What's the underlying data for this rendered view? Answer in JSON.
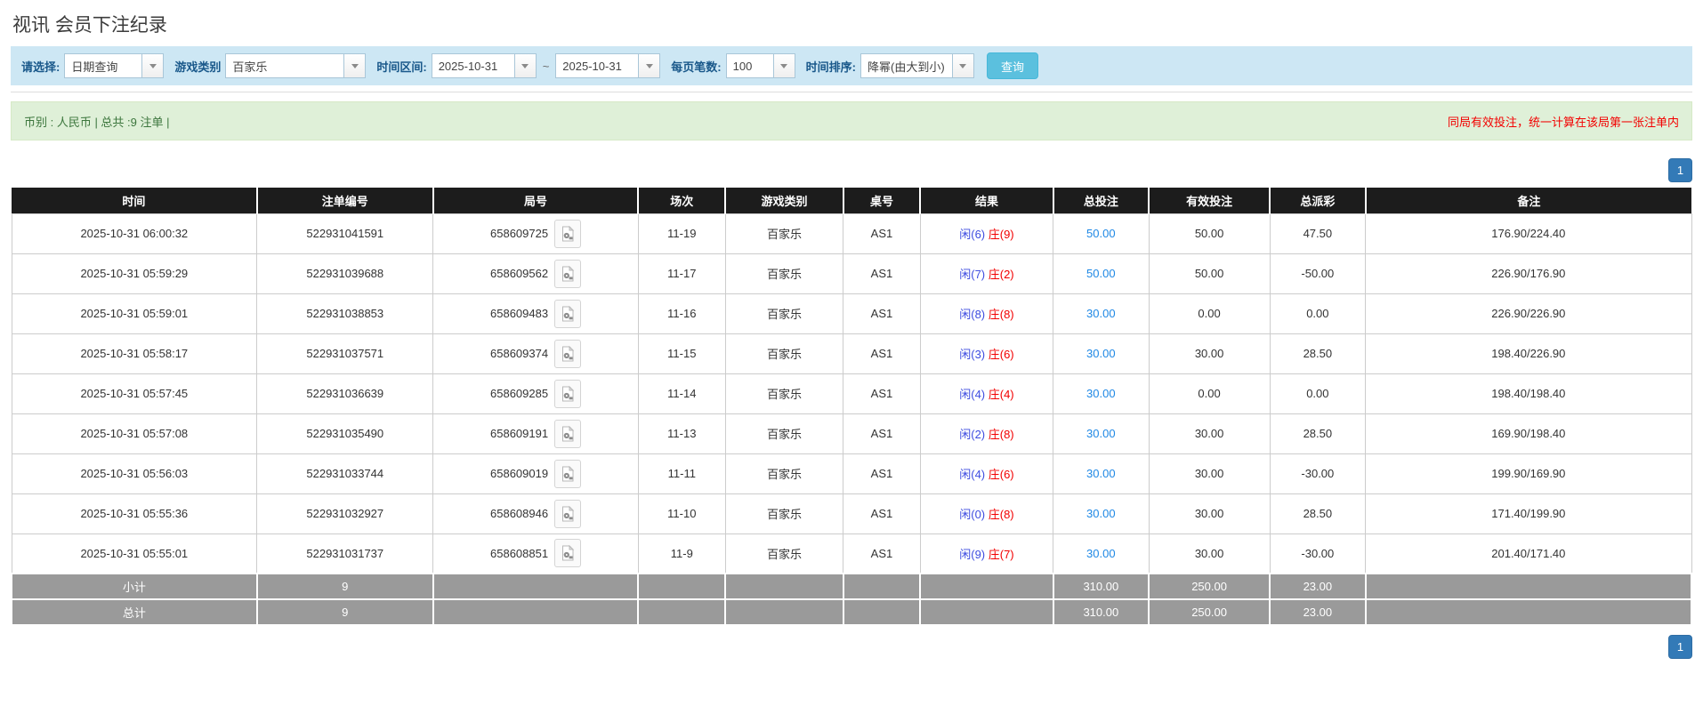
{
  "page": {
    "title": "视讯 会员下注纪录"
  },
  "filters": {
    "select_label": "请选择:",
    "select_value": "日期查询",
    "game_label": "游戏类别",
    "game_value": "百家乐",
    "range_label": "时间区间:",
    "date_from": "2025-10-31",
    "tilde": "~",
    "date_to": "2025-10-31",
    "per_page_label": "每页笔数:",
    "per_page_value": "100",
    "sort_label": "时间排序:",
    "sort_value": "降幂(由大到小)",
    "search_button": "查询"
  },
  "summary": {
    "left": "币别 : 人民币 | 总共 :9 注单 |",
    "right_notice": "同局有效投注，统一计算在该局第一张注单内"
  },
  "pagination": {
    "page": "1"
  },
  "table": {
    "headers": [
      "时间",
      "注单编号",
      "局号",
      "场次",
      "游戏类别",
      "桌号",
      "结果",
      "总投注",
      "有效投注",
      "总派彩",
      "备注"
    ],
    "rows": [
      {
        "time": "2025-10-31 06:00:32",
        "bet_id": "522931041591",
        "round_id": "658609725",
        "session": "11-19",
        "game": "百家乐",
        "table_no": "AS1",
        "player": "闲(6)",
        "banker": "庄(9)",
        "total_bet": "50.00",
        "valid_bet": "50.00",
        "payout": "47.50",
        "remark": "176.90/224.40"
      },
      {
        "time": "2025-10-31 05:59:29",
        "bet_id": "522931039688",
        "round_id": "658609562",
        "session": "11-17",
        "game": "百家乐",
        "table_no": "AS1",
        "player": "闲(7)",
        "banker": "庄(2)",
        "total_bet": "50.00",
        "valid_bet": "50.00",
        "payout": "-50.00",
        "remark": "226.90/176.90"
      },
      {
        "time": "2025-10-31 05:59:01",
        "bet_id": "522931038853",
        "round_id": "658609483",
        "session": "11-16",
        "game": "百家乐",
        "table_no": "AS1",
        "player": "闲(8)",
        "banker": "庄(8)",
        "total_bet": "30.00",
        "valid_bet": "0.00",
        "payout": "0.00",
        "remark": "226.90/226.90"
      },
      {
        "time": "2025-10-31 05:58:17",
        "bet_id": "522931037571",
        "round_id": "658609374",
        "session": "11-15",
        "game": "百家乐",
        "table_no": "AS1",
        "player": "闲(3)",
        "banker": "庄(6)",
        "total_bet": "30.00",
        "valid_bet": "30.00",
        "payout": "28.50",
        "remark": "198.40/226.90"
      },
      {
        "time": "2025-10-31 05:57:45",
        "bet_id": "522931036639",
        "round_id": "658609285",
        "session": "11-14",
        "game": "百家乐",
        "table_no": "AS1",
        "player": "闲(4)",
        "banker": "庄(4)",
        "total_bet": "30.00",
        "valid_bet": "0.00",
        "payout": "0.00",
        "remark": "198.40/198.40"
      },
      {
        "time": "2025-10-31 05:57:08",
        "bet_id": "522931035490",
        "round_id": "658609191",
        "session": "11-13",
        "game": "百家乐",
        "table_no": "AS1",
        "player": "闲(2)",
        "banker": "庄(8)",
        "total_bet": "30.00",
        "valid_bet": "30.00",
        "payout": "28.50",
        "remark": "169.90/198.40"
      },
      {
        "time": "2025-10-31 05:56:03",
        "bet_id": "522931033744",
        "round_id": "658609019",
        "session": "11-11",
        "game": "百家乐",
        "table_no": "AS1",
        "player": "闲(4)",
        "banker": "庄(6)",
        "total_bet": "30.00",
        "valid_bet": "30.00",
        "payout": "-30.00",
        "remark": "199.90/169.90"
      },
      {
        "time": "2025-10-31 05:55:36",
        "bet_id": "522931032927",
        "round_id": "658608946",
        "session": "11-10",
        "game": "百家乐",
        "table_no": "AS1",
        "player": "闲(0)",
        "banker": "庄(8)",
        "total_bet": "30.00",
        "valid_bet": "30.00",
        "payout": "28.50",
        "remark": "171.40/199.90"
      },
      {
        "time": "2025-10-31 05:55:01",
        "bet_id": "522931031737",
        "round_id": "658608851",
        "session": "11-9",
        "game": "百家乐",
        "table_no": "AS1",
        "player": "闲(9)",
        "banker": "庄(7)",
        "total_bet": "30.00",
        "valid_bet": "30.00",
        "payout": "-30.00",
        "remark": "201.40/171.40"
      }
    ],
    "footer": [
      {
        "label": "小计",
        "count": "9",
        "total_bet": "310.00",
        "valid_bet": "250.00",
        "payout": "23.00"
      },
      {
        "label": "总计",
        "count": "9",
        "total_bet": "310.00",
        "valid_bet": "250.00",
        "payout": "23.00"
      }
    ]
  },
  "icons": {
    "combo_arrow": "chevron-down-icon",
    "video_replay": "film-icon"
  },
  "colors": {
    "filter_bar_bg": "#cde7f4",
    "filter_label": "#19588a",
    "search_button_bg": "#5bc0de",
    "summary_bg": "#dff0d8",
    "summary_text": "#3c763d",
    "notice_red": "#f30000",
    "header_bg": "#1c1c1c",
    "footer_bg": "#9a9a9a",
    "pagination_blue": "#337ab7",
    "player_blue": "#3d4ce0",
    "banker_red": "#f20000",
    "bet_link_blue": "#1e88e5",
    "negative_red": "#f20000"
  }
}
